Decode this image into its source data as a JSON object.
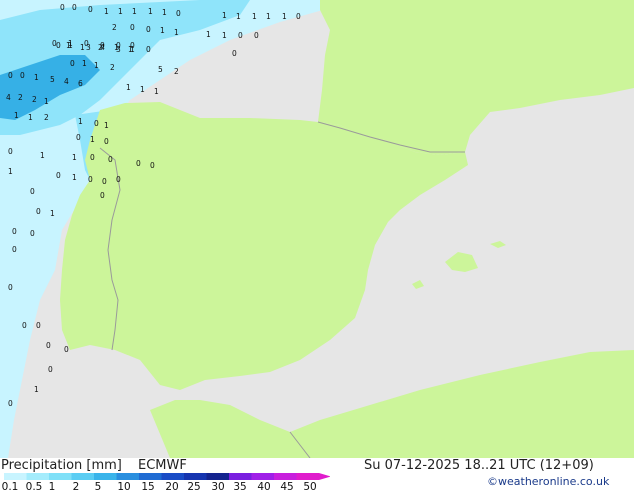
{
  "footer": {
    "product_label": "Precipitation [mm]",
    "model": "ECMWF",
    "valid_time": "Su 07-12-2025 18..21 UTC (12+09)",
    "credit": "©weatheronline.co.uk"
  },
  "legend": {
    "ticks": [
      "0.1",
      "0.5",
      "1",
      "2",
      "5",
      "10",
      "15",
      "20",
      "25",
      "30",
      "35",
      "40",
      "45",
      "50"
    ],
    "colors": [
      "#c8f4ff",
      "#a4ecfc",
      "#7fe0f8",
      "#5bcdf3",
      "#3ab4ea",
      "#2a8fdf",
      "#1f6bd3",
      "#1a4cc6",
      "#1635b0",
      "#14248f",
      "#7a1fe0",
      "#a020e8",
      "#c81fdd",
      "#e01ccc"
    ]
  },
  "colors": {
    "sea": "#e6e6e6",
    "land": "#ccf59a",
    "border": "#9a9a9a",
    "precip_light": "#c8f4ff",
    "precip_mid": "#8fe4fa",
    "precip_heavy": "#36b0e6"
  },
  "map": {
    "precip_values": [
      "0",
      "0",
      "0",
      "1",
      "1",
      "1",
      "1",
      "1",
      "0",
      "1",
      "1",
      "1",
      "1",
      "1",
      "0",
      "2",
      "0",
      "0",
      "1",
      "1",
      "1",
      "1",
      "0",
      "0",
      "0",
      "0",
      "1",
      "0",
      "0",
      "0",
      "0",
      "0",
      "1",
      "1",
      "2",
      "1",
      "1",
      "0",
      "1",
      "3",
      "4",
      "3",
      "1",
      "0",
      "1",
      "1",
      "2",
      "5",
      "2",
      "0",
      "0",
      "1",
      "5",
      "4",
      "6",
      "1",
      "1",
      "1",
      "4",
      "2",
      "2",
      "1",
      "1",
      "1",
      "2",
      "1",
      "0",
      "1",
      "0",
      "1",
      "0",
      "0",
      "1",
      "1",
      "0",
      "0",
      "0",
      "0",
      "1",
      "0",
      "1",
      "0",
      "0",
      "0",
      "0",
      "1",
      "0",
      "0",
      "0",
      "0",
      "0",
      "0",
      "0",
      "0",
      "1",
      "0",
      "0",
      "0",
      "0",
      "1",
      "0",
      "0"
    ]
  }
}
